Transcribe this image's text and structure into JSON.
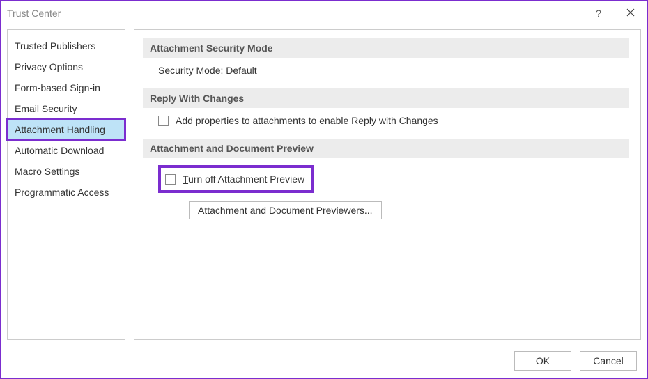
{
  "window": {
    "title": "Trust Center"
  },
  "sidebar": {
    "items": [
      {
        "label": "Trusted Publishers",
        "selected": false
      },
      {
        "label": "Privacy Options",
        "selected": false
      },
      {
        "label": "Form-based Sign-in",
        "selected": false
      },
      {
        "label": "Email Security",
        "selected": false
      },
      {
        "label": "Attachment Handling",
        "selected": true,
        "highlighted": true
      },
      {
        "label": "Automatic Download",
        "selected": false
      },
      {
        "label": "Macro Settings",
        "selected": false
      },
      {
        "label": "Programmatic Access",
        "selected": false
      }
    ]
  },
  "content": {
    "sections": {
      "security_mode": {
        "title": "Attachment Security Mode",
        "value": "Security Mode: Default"
      },
      "reply_changes": {
        "title": "Reply With Changes",
        "checkbox_label": "Add properties to attachments to enable Reply with Changes"
      },
      "preview": {
        "title": "Attachment and Document Preview",
        "checkbox_label": "Turn off Attachment Preview",
        "button_label": "Attachment and Document Previewers..."
      }
    }
  },
  "footer": {
    "ok_label": "OK",
    "cancel_label": "Cancel"
  },
  "titlebar": {
    "help_label": "?"
  },
  "annotations": {
    "highlight_color": "#7b2dcf"
  }
}
